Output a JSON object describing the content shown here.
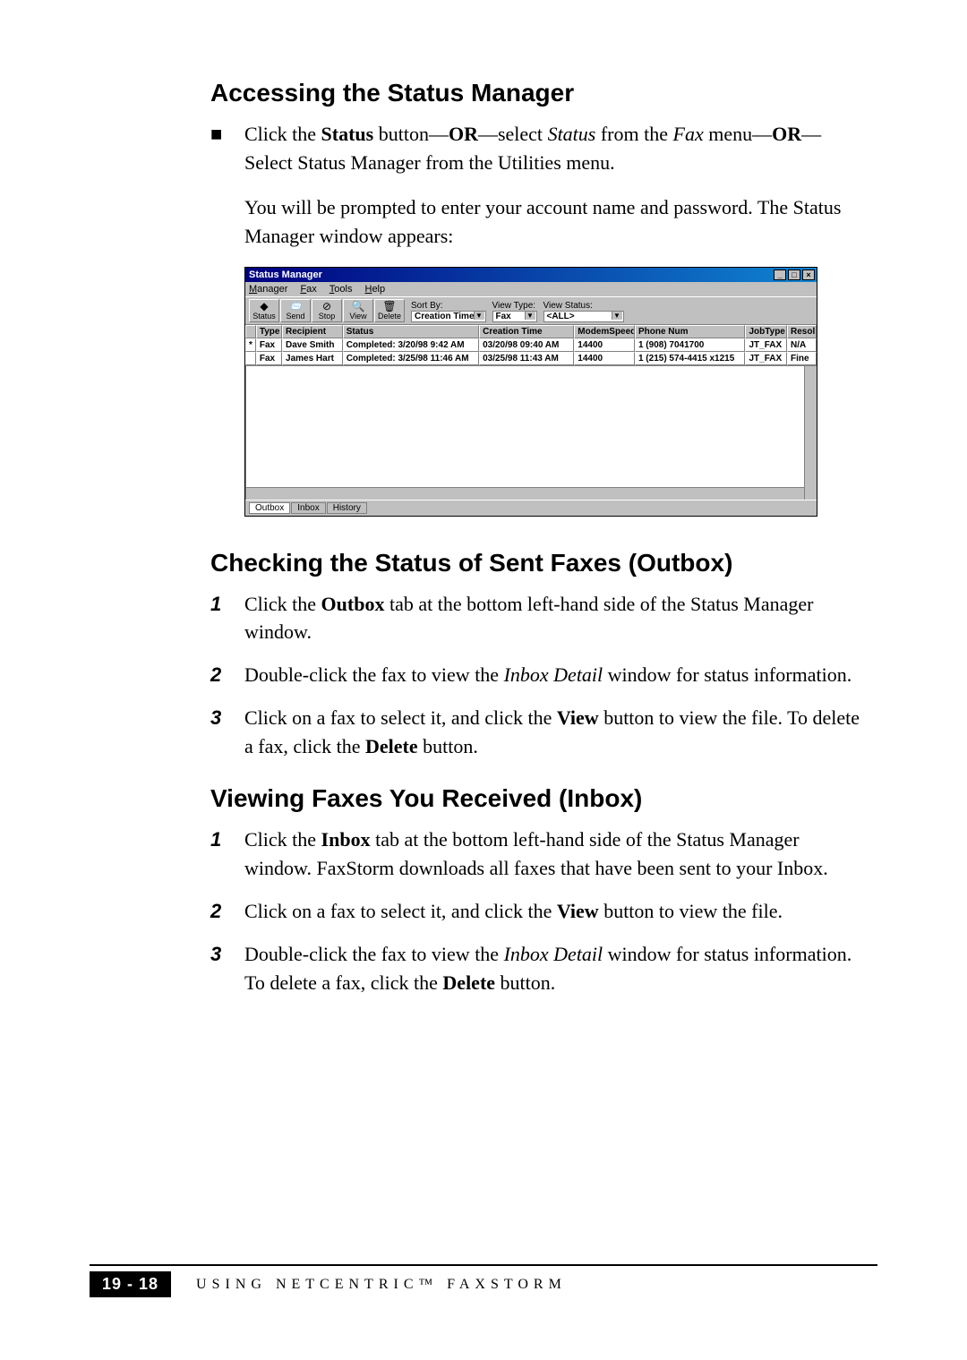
{
  "section1": {
    "heading": "Accessing the Status Manager",
    "bullet_html": "Click the <b>Status</b> button—<b>OR</b>—select <i>Status</i> from the <i>Fax</i> menu—<b>OR</b>—Select Status Manager from the Utilities menu.",
    "subpara": "You will be prompted to enter your account name and password. The Status Manager window appears:"
  },
  "window": {
    "title": "Status Manager",
    "menus": [
      "Manager",
      "Fax",
      "Tools",
      "Help"
    ],
    "menu_underline_idx": [
      0,
      0,
      0,
      0
    ],
    "toolbar_buttons": [
      {
        "icon": "◆",
        "label": "Status"
      },
      {
        "icon": "📨",
        "label": "Send"
      },
      {
        "icon": "⊘",
        "label": "Stop"
      },
      {
        "icon": "🔍",
        "label": "View"
      },
      {
        "icon": "🗑",
        "label": "Delete"
      }
    ],
    "sort_by_label": "Sort By:",
    "sort_by_value": "Creation Time",
    "view_type_label": "View Type:",
    "view_type_value": "Fax",
    "view_status_label": "View Status:",
    "view_status_value": "<ALL>",
    "columns": [
      "",
      "Type",
      "Recipient",
      "Status",
      "Creation Time",
      "ModemSpeed",
      "Phone Num",
      "JobType",
      "Resol"
    ],
    "rows": [
      {
        "mark": "*",
        "type": "Fax",
        "recipient": "Dave Smith",
        "status": "Completed: 3/20/98 9:42 AM",
        "creation": "03/20/98 09:40 AM",
        "speed": "14400",
        "phone": "1 (908) 7041700",
        "jobtype": "JT_FAX",
        "resol": "N/A"
      },
      {
        "mark": "",
        "type": "Fax",
        "recipient": "James  Hart",
        "status": "Completed: 3/25/98 11:46 AM",
        "creation": "03/25/98 11:43 AM",
        "speed": "14400",
        "phone": "1 (215) 574-4415 x1215",
        "jobtype": "JT_FAX",
        "resol": "Fine"
      }
    ],
    "tabs": [
      "Outbox",
      "Inbox",
      "History"
    ]
  },
  "section2": {
    "heading": "Checking the Status of Sent Faxes (Outbox)",
    "items": [
      "Click the <b>Outbox</b> tab at the bottom left-hand side of the Status Manager window.",
      "Double-click the fax to view the <i>Inbox Detail</i> window for status information.",
      "Click on a fax to select it, and click the <b>View</b> button to view the file. To delete a fax, click the <b>Delete</b> button."
    ]
  },
  "section3": {
    "heading": "Viewing Faxes You Received (Inbox)",
    "items": [
      "Click the <b>Inbox</b> tab at the bottom left-hand side of the Status Manager window. FaxStorm downloads all faxes that have been sent to your Inbox.",
      "Click on a fax to select it, and click the <b>View</b> button to view the file.",
      "Double-click the fax to view the <i>Inbox Detail</i> window for status information. To delete a fax, click the <b>Delete</b> button."
    ]
  },
  "footer": {
    "page": "19 - 18",
    "text": "USING NETCENTRIC™ FAXSTORM"
  }
}
